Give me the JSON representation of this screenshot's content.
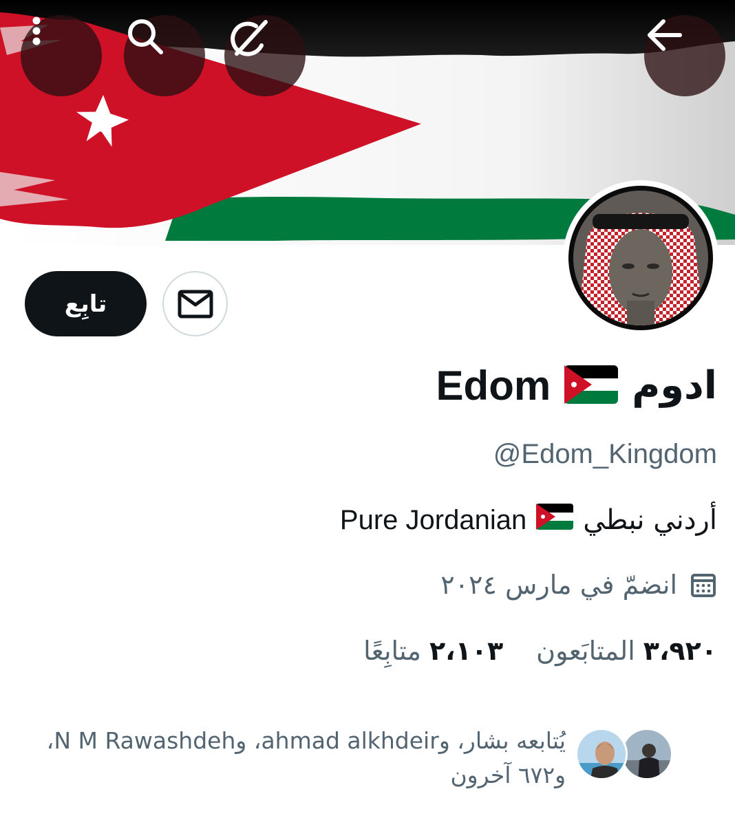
{
  "header": {
    "more_icon": "more-vertical-icon",
    "search_icon": "search-icon",
    "grok_icon": "grok-icon",
    "back_icon": "arrow-left-icon"
  },
  "profile": {
    "name_arabic": "ادوم",
    "name_latin": "Edom",
    "handle": "@Edom_Kingdom",
    "bio_arabic": "أردني نبطي",
    "bio_latin": "Pure Jordanian",
    "joined": "انضمّ في مارس ٢٠٢٤",
    "followers_count": "٣،٩٢٠",
    "followers_label": "المتابَعون",
    "following_count": "٢،١٠٣",
    "following_label": "متابِعًا",
    "followed_by": "يُتابعه بشار، وahmad alkhdeir، وN M Rawashdeh، و٦٧٢ آخرون"
  },
  "actions": {
    "follow_label": "تابِع",
    "message_icon": "mail-icon"
  },
  "colors": {
    "primary_text": "#0f1419",
    "secondary_text": "#536471",
    "button_dark": "#0f1419",
    "border": "#cfd9de",
    "flag_red": "#ce1126",
    "flag_green": "#007a3d"
  }
}
